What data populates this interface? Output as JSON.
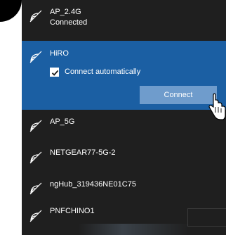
{
  "networks": [
    {
      "name": "AP_2.4G",
      "status": "Connected"
    },
    {
      "name": "HiRO",
      "checkbox_label": "Connect automatically",
      "checked": true,
      "button_label": "Connect"
    },
    {
      "name": "AP_5G"
    },
    {
      "name": "NETGEAR77-5G-2"
    },
    {
      "name": "ngHub_319436NE01C75"
    },
    {
      "name": "PNFCHINO1"
    }
  ],
  "colors": {
    "panel_bg": "#1f1f1f",
    "selected_bg": "#1b5fa3",
    "connect_button_bg": "#6f9ccc",
    "text": "#ffffff"
  },
  "icons": {
    "network": "wifi-signal-icon",
    "checkbox": "checkmark-icon",
    "pointer": "hand-pointer-icon"
  }
}
